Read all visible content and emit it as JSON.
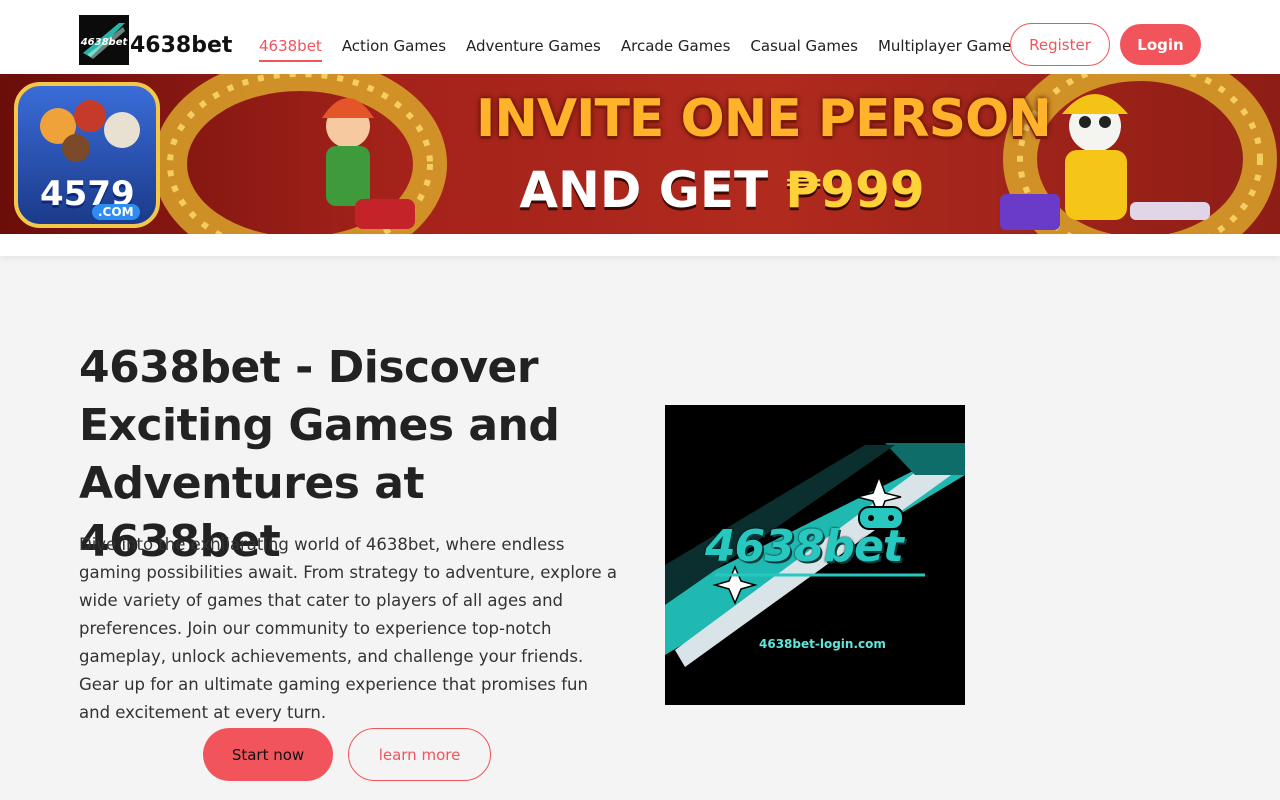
{
  "header": {
    "brand": "4638bet",
    "logo_text": "4638bet",
    "nav": [
      {
        "label": "4638bet",
        "active": true
      },
      {
        "label": "Action Games"
      },
      {
        "label": "Adventure Games"
      },
      {
        "label": "Arcade Games"
      },
      {
        "label": "Casual Games"
      },
      {
        "label": "Multiplayer Games"
      }
    ],
    "register_label": "Register",
    "login_label": "Login"
  },
  "banner": {
    "badge_number": "4579",
    "badge_domain": ".COM",
    "line1": "INVITE ONE PERSON",
    "line2_prefix": "AND GET ",
    "line2_amount": "₱999"
  },
  "hero": {
    "title": "4638bet - Discover Exciting Games and Adventures at 4638bet",
    "description": "Dive into the exhilarating world of 4638bet, where endless gaming possibilities await. From strategy to adventure, explore a wide variety of games that cater to players of all ages and preferences. Join our community to experience top-notch gameplay, unlock achievements, and challenge your friends. Gear up for an ultimate gaming experience that promises fun and excitement at every turn.",
    "start_label": "Start now",
    "learn_label": "learn more",
    "image_logo": "4638bet",
    "image_domain": "4638bet-login.com"
  },
  "colors": {
    "accent": "#f2545b",
    "banner_red": "#a3221a",
    "logo_teal": "#27c8c0"
  }
}
